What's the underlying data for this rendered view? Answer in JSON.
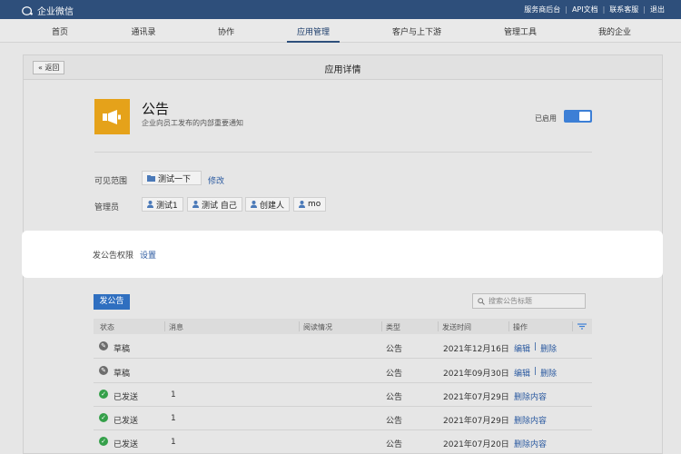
{
  "topbar": {
    "logo_text": "企业微信",
    "links": [
      "服务商后台",
      "API文档",
      "联系客服",
      "退出"
    ]
  },
  "nav": {
    "items": [
      "首页",
      "通讯录",
      "协作",
      "应用管理",
      "客户与上下游",
      "管理工具",
      "我的企业"
    ],
    "active_index": 3
  },
  "page": {
    "back_label": "返回",
    "title": "应用详情"
  },
  "app": {
    "icon": "megaphone-icon",
    "icon_color": "#e5a21a",
    "name": "公告",
    "description": "企业向员工发布的内部重要通知",
    "enabled_label": "已启用",
    "enabled": true
  },
  "visibility": {
    "label": "可见范围",
    "scope_tag": "测试一下",
    "modify_link": "修改"
  },
  "admins": {
    "label": "管理员",
    "tags": [
      "测试1",
      "测试 自己",
      "创建人",
      "mo"
    ]
  },
  "permission": {
    "label": "发公告权限",
    "link": "设置"
  },
  "toolbar": {
    "publish_button": "发公告",
    "search_placeholder": "搜索公告标题"
  },
  "table": {
    "headers": [
      "状态",
      "消息",
      "阅读情况",
      "类型",
      "发送时间",
      "操作"
    ],
    "rows": [
      {
        "status": "草稿",
        "status_kind": "draft",
        "message": "",
        "reads": "",
        "type": "公告",
        "time": "2021年12月16日",
        "ops": [
          "编辑",
          "删除"
        ]
      },
      {
        "status": "草稿",
        "status_kind": "draft",
        "message": "",
        "reads": "",
        "type": "公告",
        "time": "2021年09月30日",
        "ops": [
          "编辑",
          "删除"
        ]
      },
      {
        "status": "已发送",
        "status_kind": "sent",
        "message": "1",
        "reads": "",
        "type": "公告",
        "time": "2021年07月29日",
        "ops": [
          "删除内容"
        ]
      },
      {
        "status": "已发送",
        "status_kind": "sent",
        "message": "1",
        "reads": "",
        "type": "公告",
        "time": "2021年07月29日",
        "ops": [
          "删除内容"
        ]
      },
      {
        "status": "已发送",
        "status_kind": "sent",
        "message": "1",
        "reads": "",
        "type": "公告",
        "time": "2021年07月20日",
        "ops": [
          "删除内容"
        ]
      }
    ]
  },
  "colors": {
    "topbar": "#2e4f7b",
    "link": "#2b5aa0",
    "primary_button": "#2f6fc0",
    "sent": "#35a04a",
    "draft": "#6d6d6d"
  }
}
